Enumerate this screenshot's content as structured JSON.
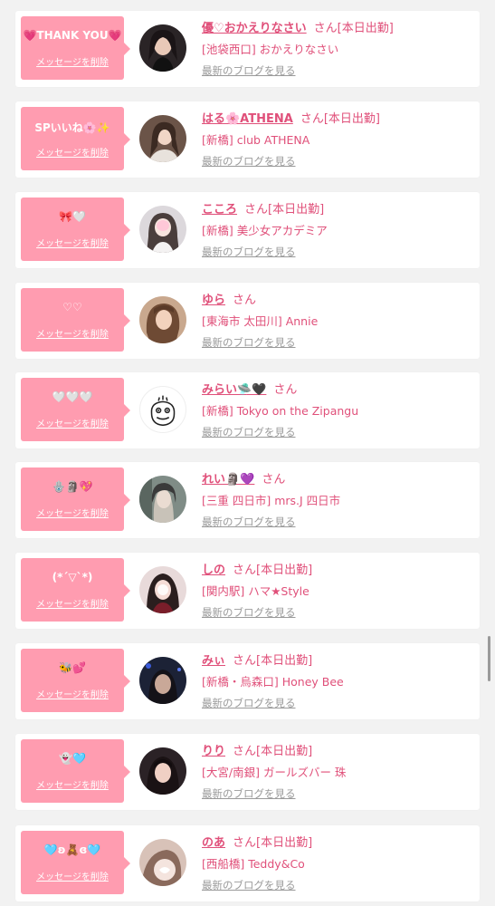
{
  "colors": {
    "bubble": "#ff9cb0",
    "name": "#e0507a",
    "link_gray": "#9a9a9a",
    "background": "#f2f2f2"
  },
  "messages": [
    {
      "bubble_text": "💗THANK YOU💗",
      "delete_label": "メッセージを削除",
      "name": "優♡おかえりなさい",
      "san": "さん",
      "status": "[本日出勤]",
      "shop": "[池袋西口] おかえりなさい",
      "blog_link": "最新のブログを見る"
    },
    {
      "bubble_text": "SPいいね🌸✨",
      "delete_label": "メッセージを削除",
      "name": "はる🌸ATHENA",
      "san": "さん",
      "status": "[本日出勤]",
      "shop": "[新橋] club ATHENA",
      "blog_link": "最新のブログを見る"
    },
    {
      "bubble_text": "🎀🤍",
      "delete_label": "メッセージを削除",
      "name": "こころ",
      "san": "さん",
      "status": "[本日出勤]",
      "shop": "[新橋] 美少女アカデミア",
      "blog_link": "最新のブログを見る"
    },
    {
      "bubble_text": "♡♡",
      "delete_label": "メッセージを削除",
      "name": "ゆら",
      "san": "さん",
      "status": "",
      "shop": "[東海市 太田川] Annie",
      "blog_link": "最新のブログを見る"
    },
    {
      "bubble_text": "🤍🤍🤍",
      "delete_label": "メッセージを削除",
      "name": "みらい🛸🖤",
      "san": "さん",
      "status": "",
      "shop": "[新橋] Tokyo on the Zipangu",
      "blog_link": "最新のブログを見る"
    },
    {
      "bubble_text": "🪬🗿💖",
      "delete_label": "メッセージを削除",
      "name": "れい🗿💜",
      "san": "さん",
      "status": "",
      "shop": "[三重 四日市] mrs.J 四日市",
      "blog_link": "最新のブログを見る"
    },
    {
      "bubble_text": "(*´▽`*)",
      "delete_label": "メッセージを削除",
      "name": "しの",
      "san": "さん",
      "status": "[本日出勤]",
      "shop": "[関内駅] ハマ★Style",
      "blog_link": "最新のブログを見る"
    },
    {
      "bubble_text": "🐝💕",
      "delete_label": "メッセージを削除",
      "name": "みぃ",
      "san": "さん",
      "status": "[本日出勤]",
      "shop": "[新橋・烏森口] Honey Bee",
      "blog_link": "最新のブログを見る"
    },
    {
      "bubble_text": "👻🩵",
      "delete_label": "メッセージを削除",
      "name": "りり",
      "san": "さん",
      "status": "[本日出勤]",
      "shop": "[大宮/南銀] ガールズバー 珠",
      "blog_link": "最新のブログを見る"
    },
    {
      "bubble_text": "🩵ʚ🧸ɞ🩵",
      "delete_label": "メッセージを削除",
      "name": "のあ",
      "san": "さん",
      "status": "[本日出勤]",
      "shop": "[西船橋] Teddy&Co",
      "blog_link": "最新のブログを見る"
    }
  ]
}
